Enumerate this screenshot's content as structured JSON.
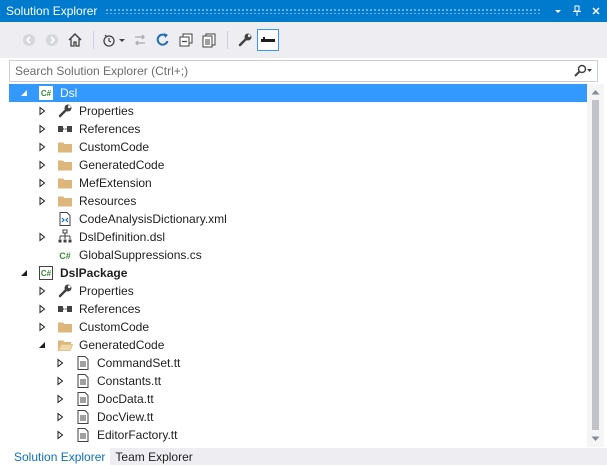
{
  "window": {
    "title": "Solution Explorer",
    "buttons": [
      "dropdown-icon",
      "pin-icon",
      "close-icon"
    ]
  },
  "toolbar": {
    "items": [
      "back-icon",
      "forward-icon",
      "home-icon",
      "pending-changes-icon",
      "sync-icon",
      "refresh-icon",
      "collapse-all-icon",
      "show-all-files-icon",
      "properties-icon",
      "preview-icon"
    ]
  },
  "search": {
    "placeholder": "Search Solution Explorer (Ctrl+;)"
  },
  "tree": {
    "rows": [
      {
        "label": "Dsl",
        "level": 0,
        "expander": "expanded",
        "icon": "csharp-project-icon",
        "bold": false,
        "selected": true
      },
      {
        "label": "Properties",
        "level": 1,
        "expander": "collapsed",
        "icon": "wrench-icon",
        "bold": false,
        "selected": false
      },
      {
        "label": "References",
        "level": 1,
        "expander": "collapsed",
        "icon": "references-icon",
        "bold": false,
        "selected": false
      },
      {
        "label": "CustomCode",
        "level": 1,
        "expander": "collapsed",
        "icon": "folder-icon",
        "bold": false,
        "selected": false
      },
      {
        "label": "GeneratedCode",
        "level": 1,
        "expander": "collapsed",
        "icon": "folder-icon",
        "bold": false,
        "selected": false
      },
      {
        "label": "MefExtension",
        "level": 1,
        "expander": "collapsed",
        "icon": "folder-icon",
        "bold": false,
        "selected": false
      },
      {
        "label": "Resources",
        "level": 1,
        "expander": "collapsed",
        "icon": "folder-icon",
        "bold": false,
        "selected": false
      },
      {
        "label": "CodeAnalysisDictionary.xml",
        "level": 1,
        "expander": "none",
        "icon": "xml-file-icon",
        "bold": false,
        "selected": false
      },
      {
        "label": "DslDefinition.dsl",
        "level": 1,
        "expander": "collapsed",
        "icon": "dsl-file-icon",
        "bold": false,
        "selected": false
      },
      {
        "label": "GlobalSuppressions.cs",
        "level": 1,
        "expander": "none",
        "icon": "csharp-file-icon",
        "bold": false,
        "selected": false
      },
      {
        "label": "DslPackage",
        "level": 0,
        "expander": "expanded",
        "icon": "csharp-project-icon",
        "bold": true,
        "selected": false
      },
      {
        "label": "Properties",
        "level": 1,
        "expander": "collapsed",
        "icon": "wrench-icon",
        "bold": false,
        "selected": false
      },
      {
        "label": "References",
        "level": 1,
        "expander": "collapsed",
        "icon": "references-icon",
        "bold": false,
        "selected": false
      },
      {
        "label": "CustomCode",
        "level": 1,
        "expander": "collapsed",
        "icon": "folder-icon",
        "bold": false,
        "selected": false
      },
      {
        "label": "GeneratedCode",
        "level": 1,
        "expander": "expanded",
        "icon": "folder-open-icon",
        "bold": false,
        "selected": false
      },
      {
        "label": "CommandSet.tt",
        "level": 2,
        "expander": "collapsed",
        "icon": "tt-file-icon",
        "bold": false,
        "selected": false
      },
      {
        "label": "Constants.tt",
        "level": 2,
        "expander": "collapsed",
        "icon": "tt-file-icon",
        "bold": false,
        "selected": false
      },
      {
        "label": "DocData.tt",
        "level": 2,
        "expander": "collapsed",
        "icon": "tt-file-icon",
        "bold": false,
        "selected": false
      },
      {
        "label": "DocView.tt",
        "level": 2,
        "expander": "collapsed",
        "icon": "tt-file-icon",
        "bold": false,
        "selected": false
      },
      {
        "label": "EditorFactory.tt",
        "level": 2,
        "expander": "collapsed",
        "icon": "tt-file-icon",
        "bold": false,
        "selected": false
      }
    ]
  },
  "tabs": [
    {
      "label": "Solution Explorer",
      "active": true
    },
    {
      "label": "Team Explorer",
      "active": false
    }
  ],
  "colors": {
    "accent": "#007acc",
    "selection": "#3399ff",
    "toolbar_bg": "#eeeef2",
    "folder": "#dcb67a",
    "csharp": "#388a34"
  }
}
